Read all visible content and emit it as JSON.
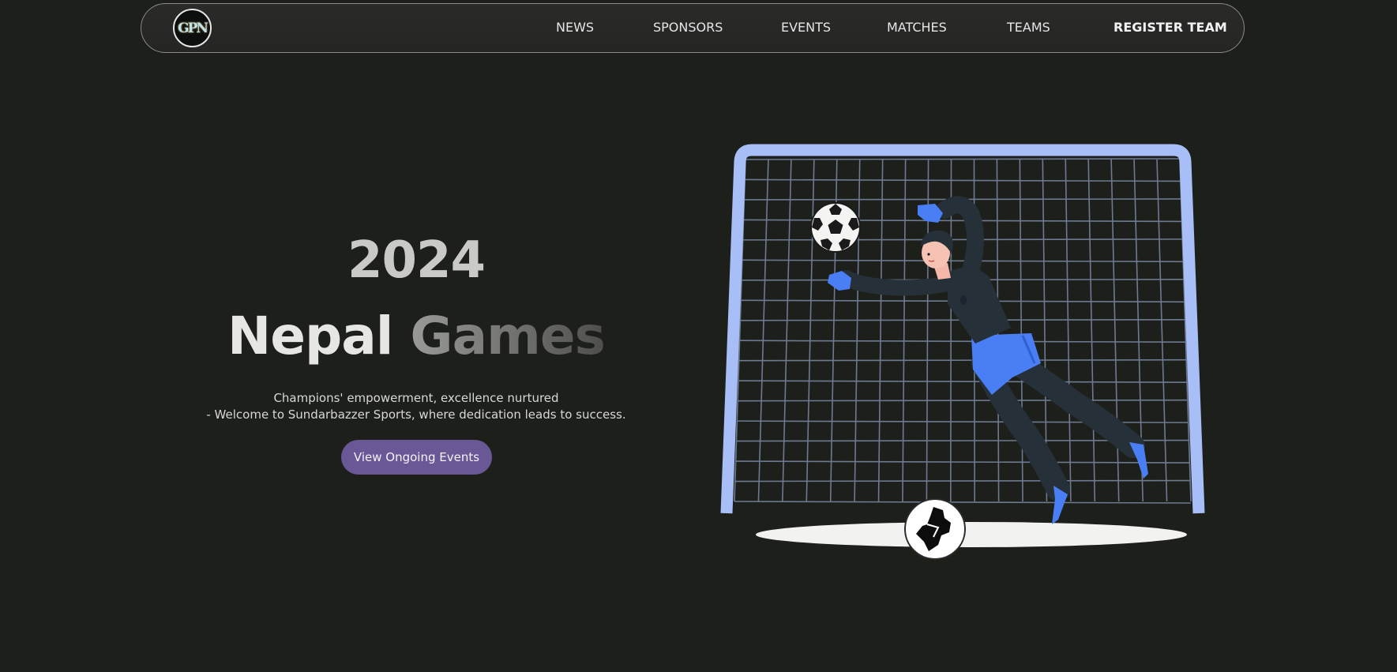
{
  "nav": {
    "logo_text": "GPN",
    "links": [
      "NEWS",
      "SPONSORS",
      "EVENTS",
      "MATCHES",
      "TEAMS"
    ],
    "cta": "REGISTER TEAM"
  },
  "hero": {
    "year": "2024",
    "title_word1": "Nepal",
    "title_word2": "Games",
    "subtitle_line1": "Champions' empowerment, excellence nurtured",
    "subtitle_line2": "- Welcome to Sundarbazzer Sports, where dedication leads to success.",
    "button_label": "View Ongoing Events"
  },
  "colors": {
    "background": "#1d1f1b",
    "button": "#6a5796",
    "goal_frame": "#a8bef7",
    "net": "#6d7a90",
    "kit_blue": "#4a7ef5",
    "kit_dark": "#263038"
  }
}
